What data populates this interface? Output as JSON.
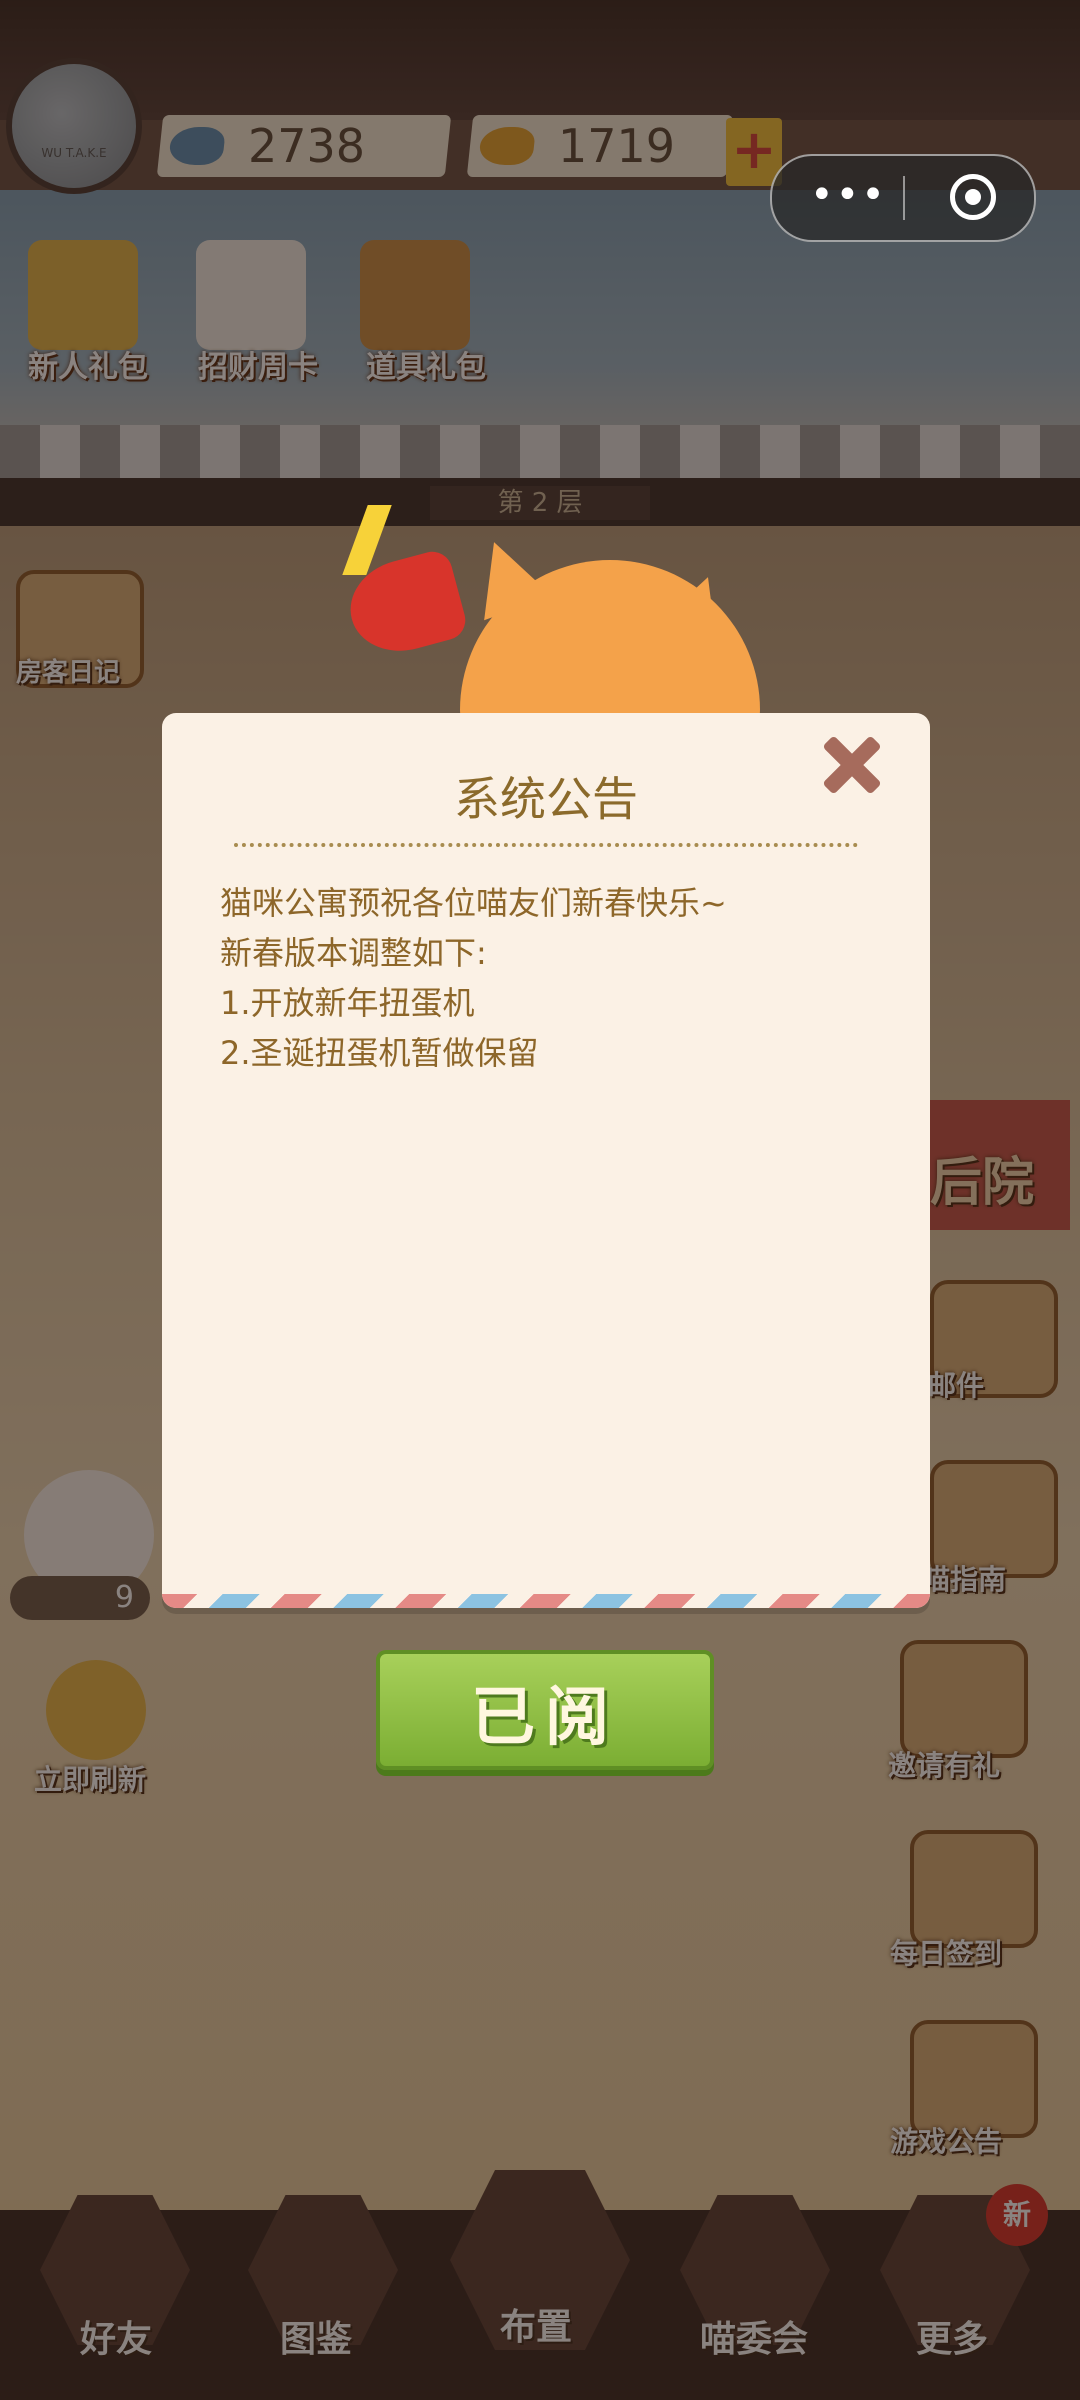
{
  "header": {
    "avatar_text": "WU T.A.K.E",
    "currency_blue_value": "2738",
    "currency_gold_value": "1719",
    "plus_symbol": "+"
  },
  "capsule": {
    "more_icon": "more-dots-icon",
    "close_icon": "target-circle-icon"
  },
  "shop": {
    "items": [
      {
        "label": "新人礼包",
        "icon": "envelope-gift-icon"
      },
      {
        "label": "招财周卡",
        "icon": "lucky-cat-icon"
      },
      {
        "label": "道具礼包",
        "icon": "box-gift-icon"
      }
    ]
  },
  "floor_label": "第 2 层",
  "left_side": {
    "items": [
      {
        "label": "房客日记",
        "icon": "diary-icon"
      },
      {
        "label": "立即刷新",
        "icon": "bell-icon"
      }
    ],
    "cat_count": "9"
  },
  "right_side": {
    "items": [
      {
        "label": "后院",
        "icon": "backyard-sign-icon"
      },
      {
        "label": "邮件",
        "icon": "mail-icon"
      },
      {
        "label": "喵指南",
        "icon": "guide-book-icon"
      },
      {
        "label": "邀请有礼",
        "icon": "invite-gift-icon"
      },
      {
        "label": "每日签到",
        "icon": "checkin-icon"
      },
      {
        "label": "游戏公告",
        "icon": "megaphone-icon"
      }
    ]
  },
  "dialog": {
    "title": "系统公告",
    "lines": [
      "猫咪公寓预祝各位喵友们新春快乐~",
      "新春版本调整如下:",
      "1.开放新年扭蛋机",
      "2.圣诞扭蛋机暂做保留"
    ],
    "confirm_label": "已阅",
    "close_icon": "close-x-icon"
  },
  "bottom_nav": {
    "items": [
      {
        "label": "好友",
        "icon": "friends-icon"
      },
      {
        "label": "图鉴",
        "icon": "album-icon"
      },
      {
        "label": "布置",
        "icon": "vase-decorate-icon"
      },
      {
        "label": "喵委会",
        "icon": "cat-committee-icon"
      },
      {
        "label": "更多",
        "icon": "question-icon"
      }
    ],
    "new_badge": "新"
  },
  "colors": {
    "dialog_bg": "#fbf1e5",
    "dialog_text": "#8d6629",
    "confirm_green": "#8fc043",
    "close_x": "#a66b5c"
  }
}
